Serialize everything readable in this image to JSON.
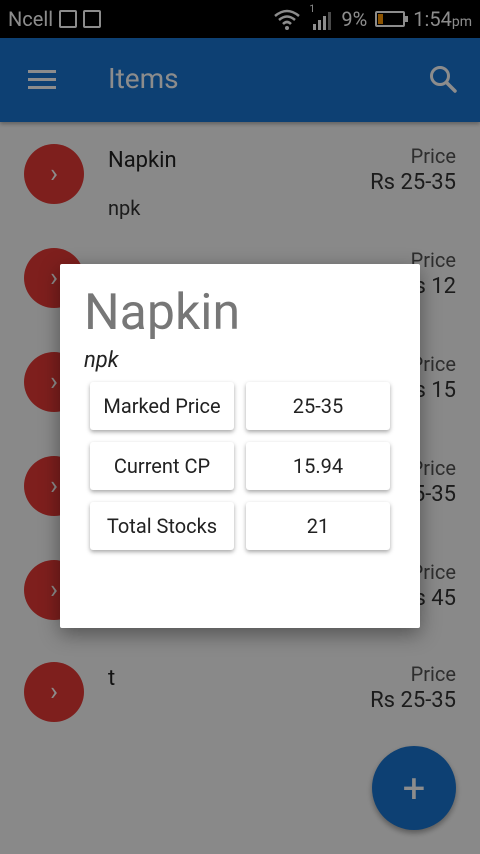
{
  "status_bar": {
    "carrier": "Ncell",
    "signal_label": "1",
    "battery": "9%",
    "time": "1:54",
    "ampm": "pm",
    "battery_color": "#ff9800"
  },
  "app_bar": {
    "title": "Items",
    "color": "#1976d2"
  },
  "list": {
    "items": [
      {
        "name": "Napkin",
        "code": "npk",
        "price_label": "Price",
        "price": "Rs 25-35"
      },
      {
        "name": "",
        "code": "",
        "price_label": "Price",
        "price": "Rs 12"
      },
      {
        "name": "",
        "code": "",
        "price_label": "Price",
        "price": "Rs 15"
      },
      {
        "name": "",
        "code": "",
        "price_label": "Price",
        "price": "Rs 25-35"
      },
      {
        "name": "",
        "code": "",
        "price_label": "Price",
        "price": "Rs 45"
      },
      {
        "name": "t",
        "code": "",
        "price_label": "Price",
        "price": "Rs 25-35"
      }
    ],
    "avatar_color": "#e53935"
  },
  "dialog": {
    "title": "Napkin",
    "subtitle": "npk",
    "rows": [
      {
        "label": "Marked Price",
        "value": "25-35"
      },
      {
        "label": "Current CP",
        "value": "15.94"
      },
      {
        "label": "Total Stocks",
        "value": "21"
      }
    ]
  },
  "fab": {
    "label": "+"
  }
}
